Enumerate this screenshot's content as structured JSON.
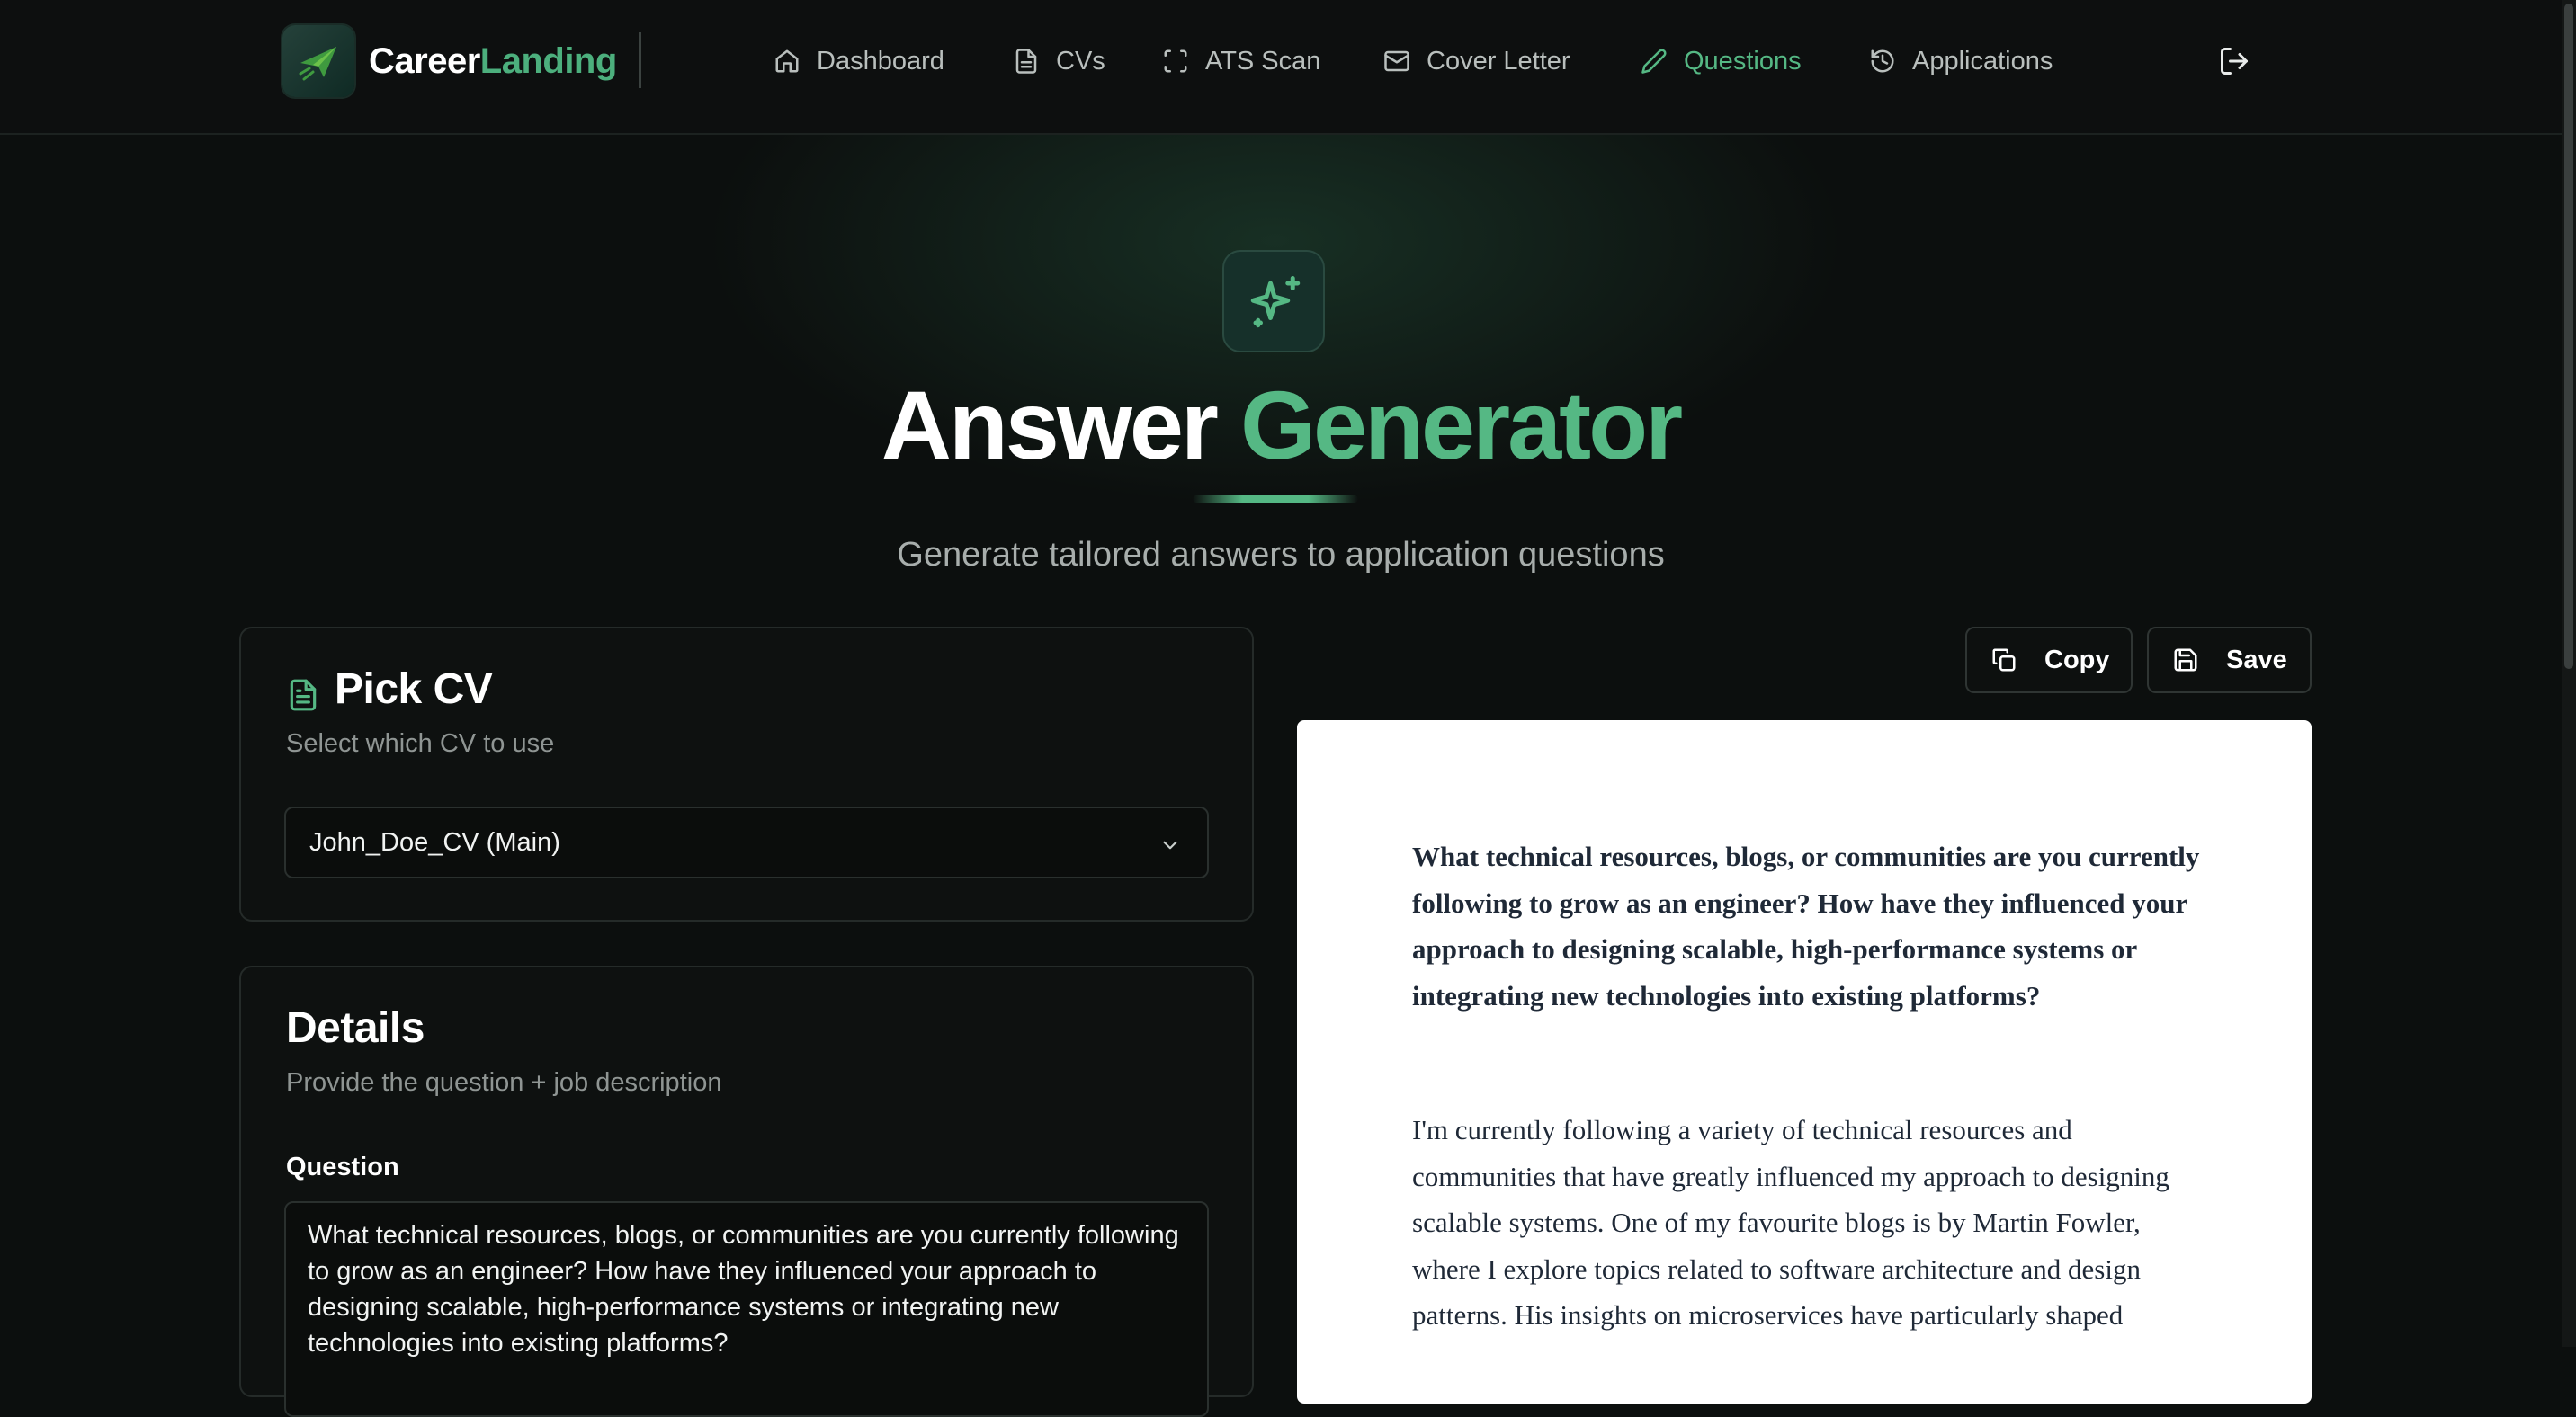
{
  "brand": {
    "name_part1": "Career",
    "name_part2": "Landing"
  },
  "nav": {
    "items": [
      {
        "label": "Dashboard",
        "icon": "home-icon"
      },
      {
        "label": "CVs",
        "icon": "file-icon"
      },
      {
        "label": "ATS Scan",
        "icon": "scan-icon"
      },
      {
        "label": "Cover Letter",
        "icon": "mail-icon"
      },
      {
        "label": "Questions",
        "icon": "pencil-icon",
        "active": true
      },
      {
        "label": "Applications",
        "icon": "history-icon"
      }
    ],
    "logout_icon": "logout-icon"
  },
  "hero": {
    "icon": "sparkles-icon",
    "title_part1": "Answer",
    "title_part2": "Generator",
    "subtitle": "Generate tailored answers to application questions"
  },
  "pick_cv": {
    "title": "Pick CV",
    "subtitle": "Select which CV to use",
    "selected": "John_Doe_CV (Main)"
  },
  "details": {
    "title": "Details",
    "subtitle": "Provide the question + job description",
    "question_label": "Question",
    "question_value": "What technical resources, blogs, or communities are you currently following to grow as an engineer? How have they influenced your approach to designing scalable, high-performance systems or integrating new technologies into existing platforms?"
  },
  "actions": {
    "copy_label": "Copy",
    "save_label": "Save"
  },
  "document": {
    "question": "What technical resources, blogs, or communities are you currently following to grow as an engineer? How have they influenced your approach to designing scalable, high-performance systems or integrating new technologies into existing platforms?",
    "answer": "I'm currently following a variety of technical resources and communities that have greatly influenced my approach to designing scalable systems. One of my favourite blogs is by Martin Fowler, where I explore topics related to software architecture and design patterns. His insights on microservices have particularly shaped"
  },
  "colors": {
    "accent": "#55b884",
    "background": "#0c0f0e",
    "card_border": "#252b29"
  }
}
